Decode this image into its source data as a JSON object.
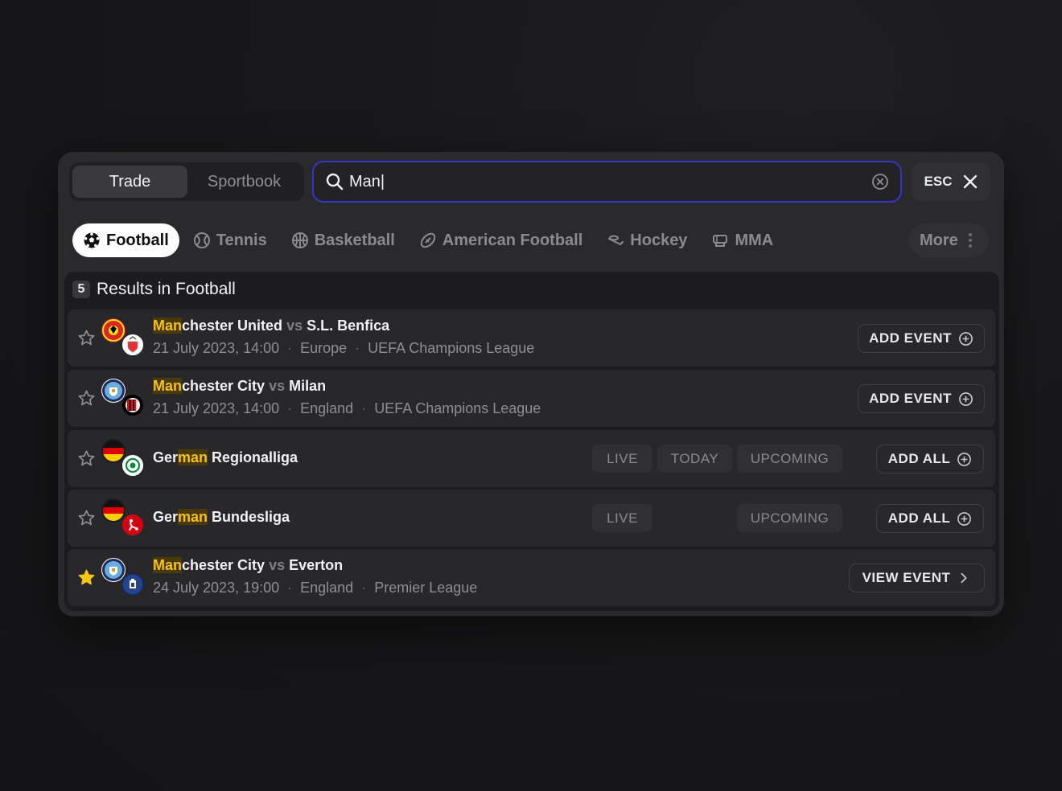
{
  "mode": {
    "trade": "Trade",
    "sportbook": "Sportbook"
  },
  "search": {
    "value": "Man|"
  },
  "esc": {
    "label": "ESC"
  },
  "sports": [
    {
      "label": "Football",
      "icon": "football-icon",
      "active": true
    },
    {
      "label": "Tennis",
      "icon": "tennis-icon"
    },
    {
      "label": "Basketball",
      "icon": "basketball-icon"
    },
    {
      "label": "American Football",
      "icon": "american-football-icon"
    },
    {
      "label": "Hockey",
      "icon": "hockey-icon"
    },
    {
      "label": "MMA",
      "icon": "mma-icon"
    }
  ],
  "more": {
    "label": "More"
  },
  "results": {
    "count": "5",
    "title": "Results in Football",
    "rows": [
      {
        "hl": "Man",
        "rest": "chester United",
        "vs": "vs",
        "opponent": "S.L. Benfica",
        "date": "21 July 2023, 14:00",
        "region": "Europe",
        "league": "UEFA Champions League",
        "action": "ADD EVENT",
        "starred": false
      },
      {
        "hl": "Man",
        "rest": "chester City",
        "vs": "vs",
        "opponent": "Milan",
        "date": "21 July 2023, 14:00",
        "region": "England",
        "league": "UEFA Champions League",
        "action": "ADD EVENT",
        "starred": false
      },
      {
        "pre": "Ger",
        "hl": "man",
        "rest": " Regionalliga",
        "pills": [
          "LIVE",
          "TODAY",
          "UPCOMING"
        ],
        "action": "ADD ALL",
        "starred": false
      },
      {
        "pre": "Ger",
        "hl": "man",
        "rest": " Bundesliga",
        "pills": [
          "LIVE",
          "UPCOMING"
        ],
        "action": "ADD ALL",
        "starred": false
      },
      {
        "hl": "Man",
        "rest": "chester City",
        "vs": "vs",
        "opponent": "Everton",
        "date": "24 July 2023, 19:00",
        "region": "England",
        "league": "Premier League",
        "action": "VIEW EVENT",
        "starred": true
      }
    ]
  },
  "colors": {
    "accent": "#3434c9",
    "highlight": "#f4c21a",
    "star": "#f5c518"
  }
}
